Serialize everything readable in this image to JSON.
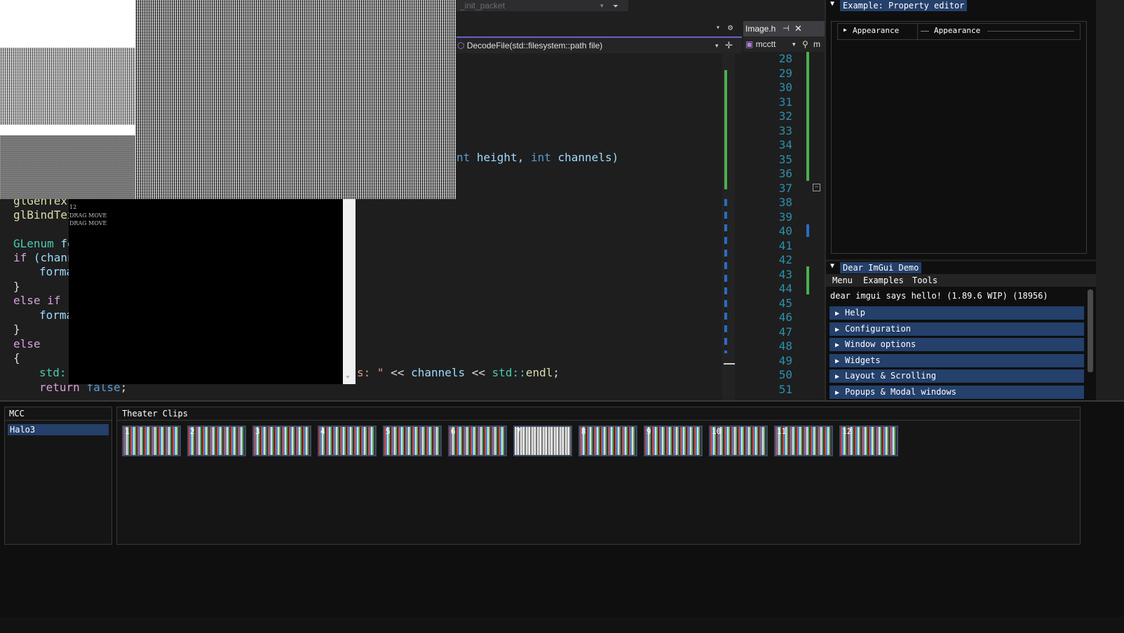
{
  "vs": {
    "top_dropdown": "_init_packet",
    "navbar_function": "DecodeFile(std::filesystem::path file)",
    "image_tab": "Image.h",
    "image_nav_scope": "mcctt",
    "image_nav_scope2": "m"
  },
  "code": {
    "sig_int": "nt",
    "sig_height": " height, ",
    "sig_int2": "int",
    "sig_channels": " channels)",
    "l_glgen": "glGenText",
    "l_glbind": "glBindTex",
    "l_glenum_type": "GLenum",
    "l_glenum_rest": " fo",
    "l_if": "if",
    "l_if_rest": " (chann",
    "l_format1": "forma",
    "l_brace_close1": "}",
    "l_else_if": "else if",
    "l_else_if_rest": " (",
    "l_format2": "forma",
    "l_brace_close2": "}",
    "l_else": "else",
    "l_brace_open": "{",
    "l_std": "std::",
    "l_cout_str": "s: \"",
    "l_cout_rest1": " << ",
    "l_cout_channels": "channels",
    "l_cout_rest2": " << ",
    "l_cout_std": "std::",
    "l_cout_endl": "endl",
    "l_cout_end": ";",
    "l_return": "return",
    "l_false": "false",
    "l_return_end": ";"
  },
  "line_numbers": [
    "28",
    "29",
    "30",
    "31",
    "32",
    "33",
    "34",
    "35",
    "36",
    "37",
    "38",
    "39",
    "40",
    "41",
    "42",
    "43",
    "44",
    "45",
    "46",
    "47",
    "48",
    "49",
    "50",
    "51"
  ],
  "console": {
    "lines": [
      "12",
      "DRAG MOVE",
      "DRAG MOVE"
    ]
  },
  "property_editor": {
    "title": "Example: Property editor",
    "tree_label": "Appearance",
    "value_label": "Appearance"
  },
  "imgui_demo": {
    "title": "Dear ImGui Demo",
    "menu": [
      "Menu",
      "Examples",
      "Tools"
    ],
    "hello": "dear imgui says hello! (1.89.6 WIP) (18956)",
    "sections": [
      "Help",
      "Configuration",
      "Window options",
      "Widgets",
      "Layout & Scrolling",
      "Popups & Modal windows"
    ]
  },
  "mcc_panel": {
    "title": "MCC",
    "items": [
      "Halo3"
    ]
  },
  "theater": {
    "title": "Theater Clips",
    "clips": [
      "1",
      "2",
      "3",
      "4",
      "5",
      "6",
      "7",
      "8",
      "9",
      "10",
      "11",
      "12"
    ]
  },
  "colors": {
    "imgui_header": "#24406b",
    "imgui_bg": "#0f0f0f",
    "vs_bg": "#1e1e1e",
    "accent_green": "#4caf50",
    "accent_blue": "#2b6cc4"
  }
}
